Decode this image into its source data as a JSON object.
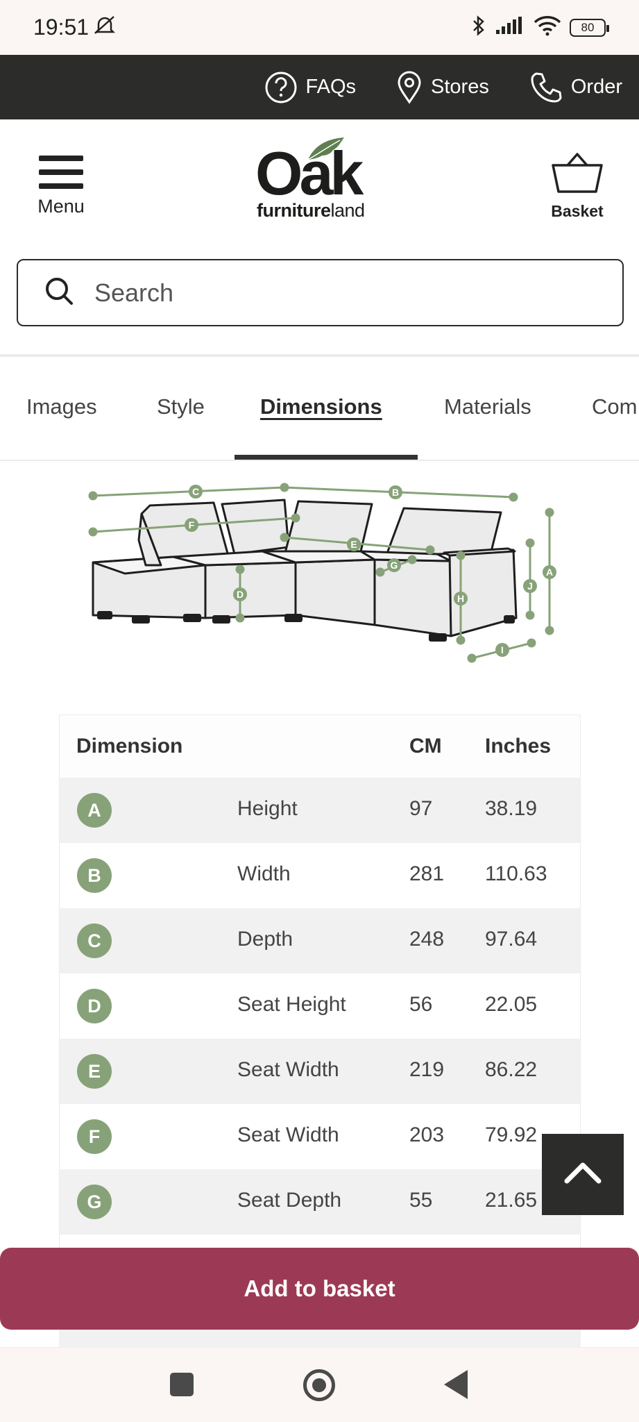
{
  "status_bar": {
    "time": "19:51",
    "battery": "80"
  },
  "utility_bar": {
    "faqs": "FAQs",
    "stores": "Stores",
    "order": "Order"
  },
  "header": {
    "menu_label": "Menu",
    "logo_main": "Oak",
    "logo_sub_bold": "furniture",
    "logo_sub_light": "land",
    "basket_label": "Basket"
  },
  "search": {
    "placeholder": "Search"
  },
  "tabs": [
    {
      "label": "Images"
    },
    {
      "label": "Style"
    },
    {
      "label": "Dimensions",
      "active": true
    },
    {
      "label": "Materials"
    },
    {
      "label": "Com"
    }
  ],
  "diagram": {
    "markers": [
      "A",
      "B",
      "C",
      "D",
      "E",
      "F",
      "G",
      "H",
      "I",
      "J"
    ]
  },
  "dimension_table": {
    "headers": {
      "dimension": "Dimension",
      "cm": "CM",
      "inches": "Inches"
    },
    "rows": [
      {
        "letter": "A",
        "label": "Height",
        "cm": "97",
        "inches": "38.19"
      },
      {
        "letter": "B",
        "label": "Width",
        "cm": "281",
        "inches": "110.63"
      },
      {
        "letter": "C",
        "label": "Depth",
        "cm": "248",
        "inches": "97.64"
      },
      {
        "letter": "D",
        "label": "Seat Height",
        "cm": "56",
        "inches": "22.05"
      },
      {
        "letter": "E",
        "label": "Seat Width",
        "cm": "219",
        "inches": "86.22"
      },
      {
        "letter": "F",
        "label": "Seat Width",
        "cm": "203",
        "inches": "79.92"
      },
      {
        "letter": "G",
        "label": "Seat Depth",
        "cm": "55",
        "inches": "21.65"
      }
    ]
  },
  "add_to_basket": "Add to basket",
  "colors": {
    "accent_green": "#87a278",
    "cta": "#9c3a55",
    "dark_bar": "#2c2c2b"
  }
}
